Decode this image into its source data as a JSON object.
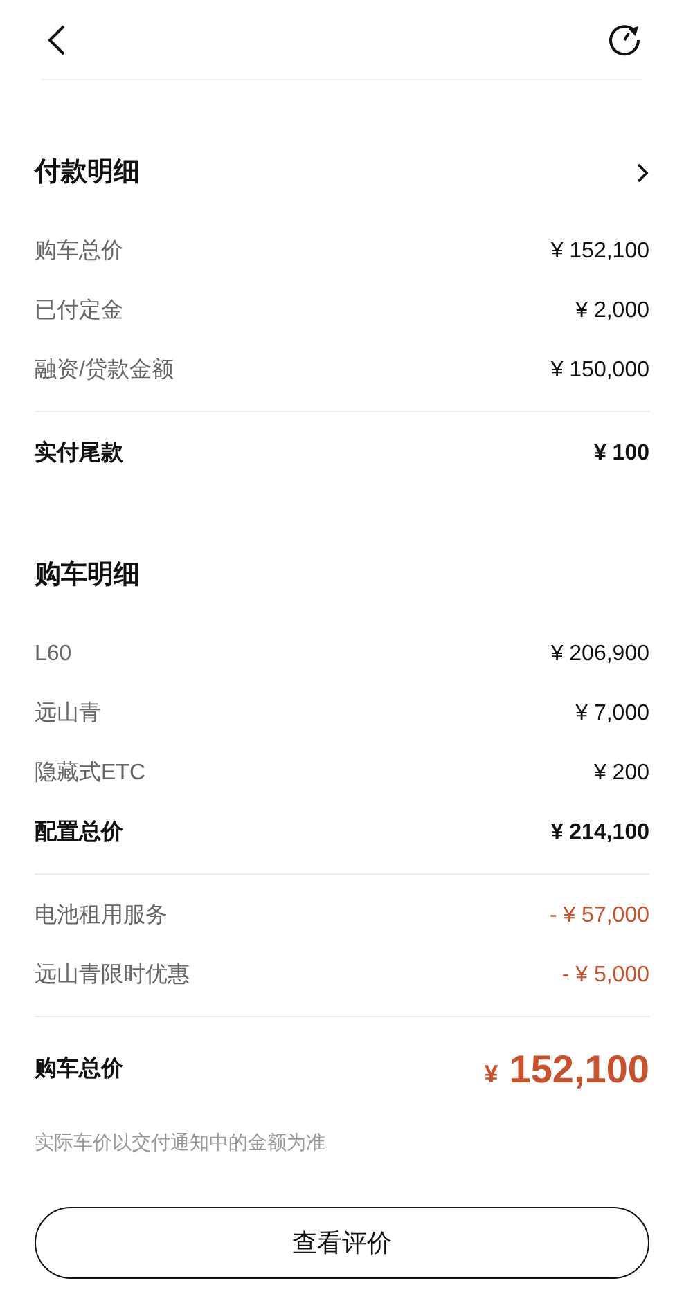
{
  "sections": [
    {
      "title": "付款明细",
      "link": true,
      "groups": [
        {
          "rows": [
            {
              "label": "购车总价",
              "value": "¥ 152,100",
              "kind": "normal"
            },
            {
              "label": "已付定金",
              "value": "¥ 2,000",
              "kind": "normal"
            },
            {
              "label": "融资/贷款金额",
              "value": "¥ 150,000",
              "kind": "normal"
            }
          ]
        },
        {
          "rows": [
            {
              "label": "实付尾款",
              "value": "¥ 100",
              "kind": "total"
            }
          ]
        }
      ]
    },
    {
      "title": "购车明细",
      "link": false,
      "groups": [
        {
          "rows": [
            {
              "label": "L60",
              "value": "¥ 206,900",
              "kind": "normal"
            },
            {
              "label": "远山青",
              "value": "¥ 7,000",
              "kind": "normal"
            },
            {
              "label": "隐藏式ETC",
              "value": "¥ 200",
              "kind": "normal"
            },
            {
              "label": "配置总价",
              "value": "¥ 214,100",
              "kind": "total"
            }
          ]
        },
        {
          "rows": [
            {
              "label": "电池租用服务",
              "value": "- ¥ 57,000",
              "kind": "discount"
            },
            {
              "label": "远山青限时优惠",
              "value": "- ¥ 5,000",
              "kind": "discount"
            }
          ]
        },
        {
          "rows": [
            {
              "label": "购车总价",
              "currency": "¥",
              "value": "152,100",
              "kind": "grand"
            }
          ]
        }
      ]
    }
  ],
  "note": "实际车价以交付通知中的金额为准",
  "button": "查看评价"
}
